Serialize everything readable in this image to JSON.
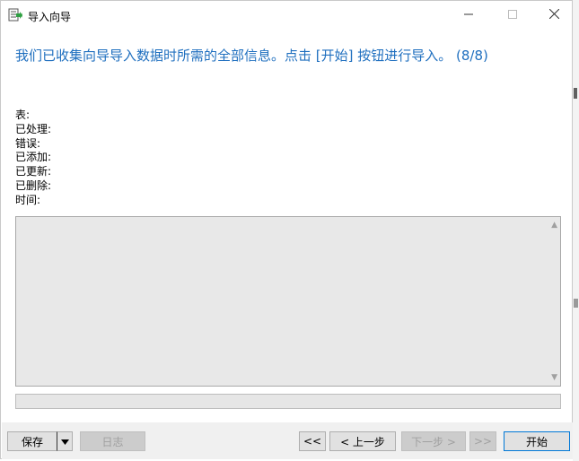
{
  "window": {
    "title": "导入向导"
  },
  "headline": "我们已收集向导导入数据时所需的全部信息。点击 [开始] 按钮进行导入。 (8/8)",
  "stats": {
    "table": "表:",
    "processed": "已处理:",
    "errors": "错误:",
    "added": "已添加:",
    "updated": "已更新:",
    "deleted": "已删除:",
    "time": "时间:"
  },
  "progress": {
    "value": 0
  },
  "buttons": {
    "save": "保存",
    "log": "日志",
    "first": "<<",
    "prev": "< 上一步",
    "next": "下一步 >",
    "last": ">>",
    "start": "开始"
  },
  "colors": {
    "headline": "#1f6fbf",
    "accent": "#0078d7"
  },
  "icons": {
    "app": "import-wizard-icon",
    "minimize": "minimize-icon",
    "maximize": "maximize-icon",
    "close": "close-icon"
  }
}
